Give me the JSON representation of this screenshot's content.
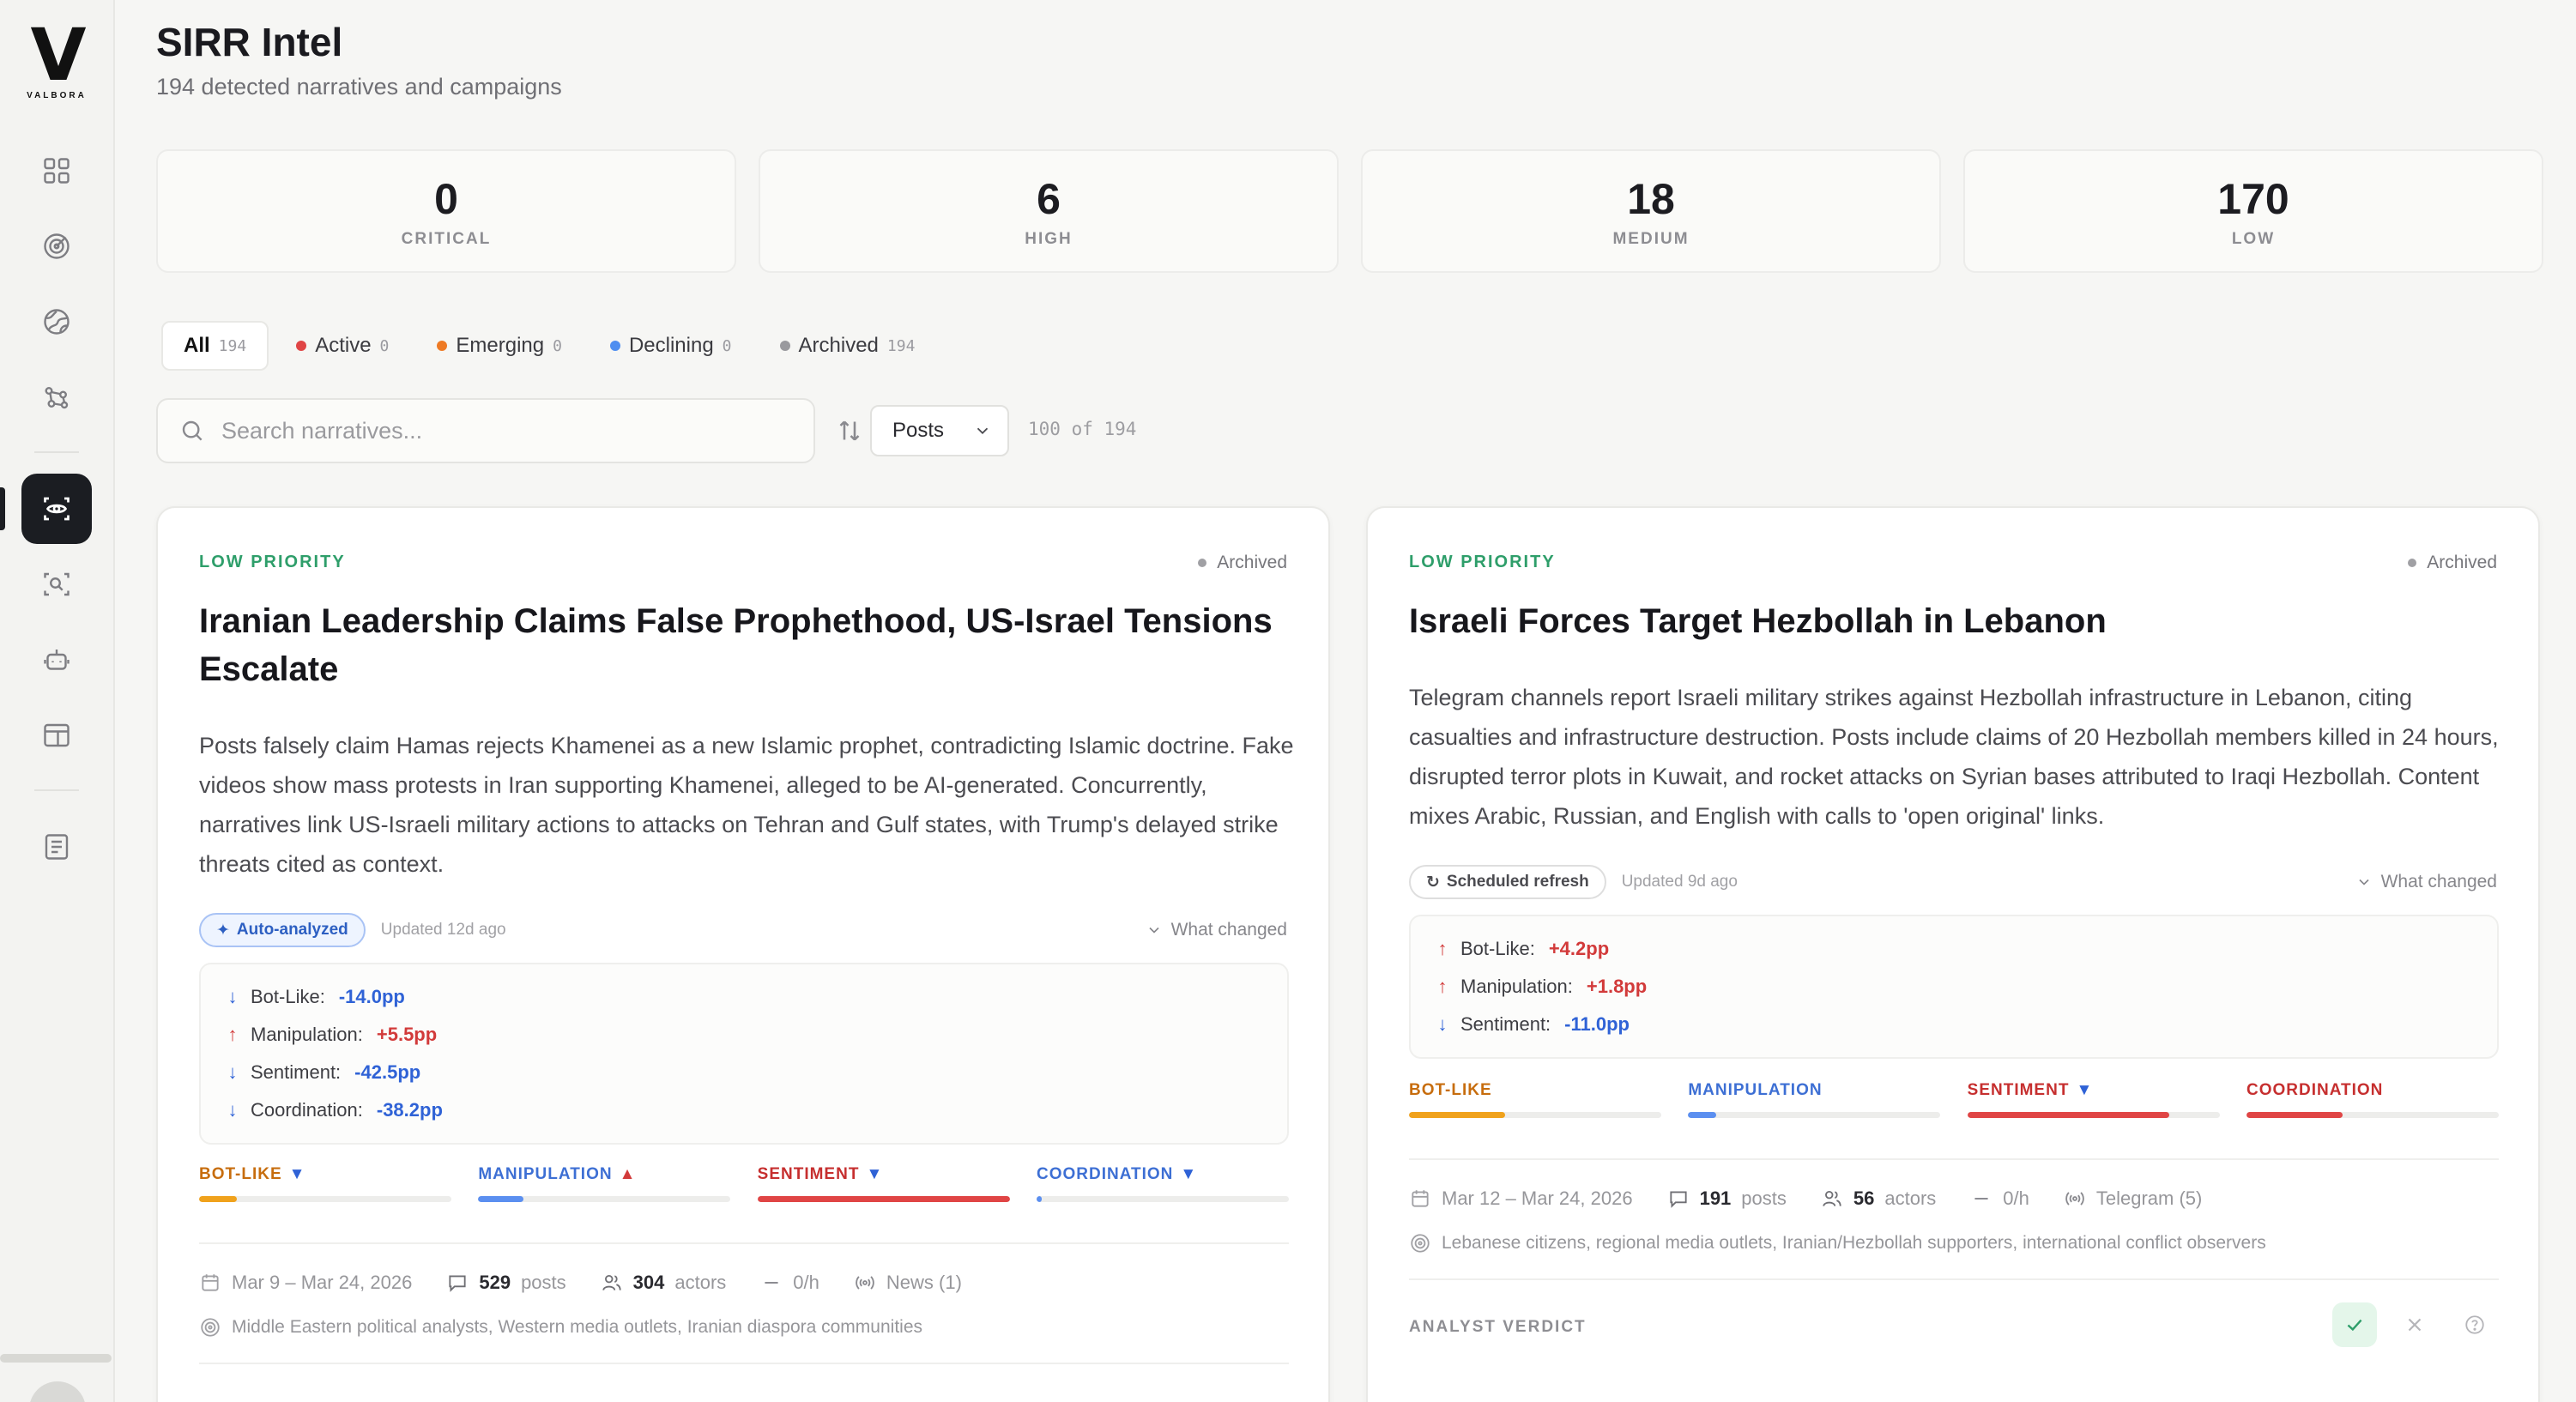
{
  "brand": {
    "logo_letter": "V",
    "logo_word": "VALBORA"
  },
  "page": {
    "title": "SIRR Intel",
    "subtitle": "194 detected narratives and campaigns"
  },
  "stats": [
    {
      "value": "0",
      "label": "CRITICAL"
    },
    {
      "value": "6",
      "label": "HIGH"
    },
    {
      "value": "18",
      "label": "MEDIUM"
    },
    {
      "value": "170",
      "label": "LOW"
    }
  ],
  "tabs": [
    {
      "label": "All",
      "count": "194",
      "color": ""
    },
    {
      "label": "Active",
      "count": "0",
      "color": "#e04545"
    },
    {
      "label": "Emerging",
      "count": "0",
      "color": "#ee7a24"
    },
    {
      "label": "Declining",
      "count": "0",
      "color": "#4e8ef0"
    },
    {
      "label": "Archived",
      "count": "194",
      "color": "#9a9a9e"
    }
  ],
  "search": {
    "placeholder": "Search narratives...",
    "value": ""
  },
  "sort": {
    "selected": "Posts",
    "count_text": "100 of 194"
  },
  "colors": {
    "bot": "#f0a21c",
    "manipulation": "#5b8ff0",
    "sentiment": "#e04545",
    "coordination": "#e04545",
    "up": "#d23a3a",
    "down": "#2f62d6"
  },
  "cards": [
    {
      "priority": "LOW PRIORITY",
      "status": "Archived",
      "title": "Iranian Leadership Claims False Prophethood, US-Israel Tensions Escalate",
      "description": "Posts falsely claim Hamas rejects Khamenei as a new Islamic prophet, contradicting Islamic doctrine. Fake videos show mass protests in Iran supporting Khamenei, alleged to be AI-generated. Concurrently, narratives link US-Israeli military actions to attacks on Tehran and Gulf states, with Trump's delayed strike threats cited as context.",
      "badge": "Auto-analyzed",
      "updated": "Updated 12d ago",
      "what_changed": "What changed",
      "changes": [
        {
          "label": "Bot-Like:",
          "value": "-14.0pp",
          "dir": "down"
        },
        {
          "label": "Manipulation:",
          "value": "+5.5pp",
          "dir": "up"
        },
        {
          "label": "Sentiment:",
          "value": "-42.5pp",
          "dir": "down"
        },
        {
          "label": "Coordination:",
          "value": "-38.2pp",
          "dir": "down"
        }
      ],
      "metrics": [
        {
          "label": "BOT-LIKE",
          "trend": "down",
          "level": 0.15
        },
        {
          "label": "MANIPULATION",
          "trend": "up",
          "level": 0.18
        },
        {
          "label": "SENTIMENT",
          "trend": "down",
          "level": 1.0
        },
        {
          "label": "COORDINATION",
          "trend": "down",
          "level": 0.02
        }
      ],
      "dates": "Mar 9 – Mar 24, 2026",
      "posts": "529",
      "posts_label": "posts",
      "actors": "304",
      "actors_label": "actors",
      "rate": "0/h",
      "source": "News (1)",
      "audience": "Middle Eastern political analysts, Western media outlets, Iranian diaspora communities",
      "verdict_label": "ANALYST VERDICT"
    },
    {
      "priority": "LOW PRIORITY",
      "status": "Archived",
      "title": "Israeli Forces Target Hezbollah in Lebanon",
      "description": "Telegram channels report Israeli military strikes against Hezbollah infrastructure in Lebanon, citing casualties and infrastructure destruction. Posts include claims of 20 Hezbollah members killed in 24 hours, disrupted terror plots in Kuwait, and rocket attacks on Syrian bases attributed to Iraqi Hezbollah. Content mixes Arabic, Russian, and English with calls to 'open original' links.",
      "badge": "Scheduled refresh",
      "updated": "Updated 9d ago",
      "what_changed": "What changed",
      "changes": [
        {
          "label": "Bot-Like:",
          "value": "+4.2pp",
          "dir": "up"
        },
        {
          "label": "Manipulation:",
          "value": "+1.8pp",
          "dir": "up"
        },
        {
          "label": "Sentiment:",
          "value": "-11.0pp",
          "dir": "down"
        }
      ],
      "metrics": [
        {
          "label": "BOT-LIKE",
          "trend": "",
          "level": 0.38
        },
        {
          "label": "MANIPULATION",
          "trend": "",
          "level": 0.11
        },
        {
          "label": "SENTIMENT",
          "trend": "down",
          "level": 0.8
        },
        {
          "label": "COORDINATION",
          "trend": "",
          "level": 0.38
        }
      ],
      "dates": "Mar 12 – Mar 24, 2026",
      "posts": "191",
      "posts_label": "posts",
      "actors": "56",
      "actors_label": "actors",
      "rate": "0/h",
      "source": "Telegram (5)",
      "audience": "Lebanese citizens, regional media outlets, Iranian/Hezbollah supporters, international conflict observers",
      "verdict_label": "ANALYST VERDICT"
    }
  ]
}
